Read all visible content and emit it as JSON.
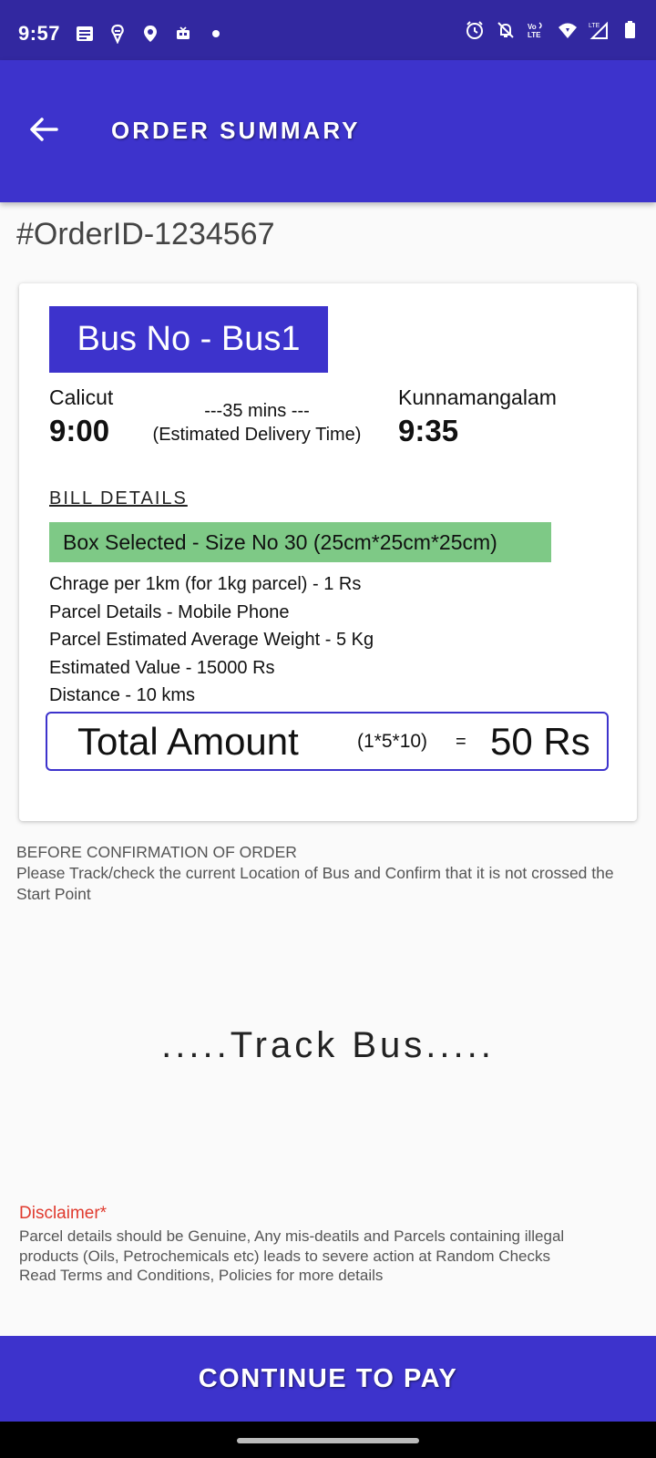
{
  "status_bar": {
    "time": "9:57",
    "left_icons": [
      "message-icon",
      "swiggy-icon",
      "location-icon",
      "media-icon",
      "dot-icon"
    ],
    "right_icons": [
      "alarm-icon",
      "notifications-off-icon",
      "volte-icon",
      "wifi-icon",
      "signal-icon",
      "battery-icon"
    ],
    "network_label": "LTE",
    "volte_label": "Vo LTE"
  },
  "app_bar": {
    "title": "ORDER SUMMARY",
    "back_icon": "arrow-left-icon"
  },
  "order_id": "#OrderID-1234567",
  "trip": {
    "bus_label": "Bus No - Bus1",
    "from_city": "Calicut",
    "from_time": "9:00",
    "duration": "---35 mins ---",
    "eta_label": "(Estimated Delivery Time)",
    "to_city": "Kunnamangalam",
    "to_time": "9:35"
  },
  "bill": {
    "heading": "BILL DETAILS",
    "box_selected": "Box Selected - Size No 30 (25cm*25cm*25cm)",
    "lines": [
      "Chrage per 1km (for 1kg parcel) - 1 Rs",
      "Parcel Details - Mobile Phone",
      "Parcel Estimated Average Weight - 5 Kg",
      "Estimated Value - 15000 Rs",
      "Distance - 10 kms"
    ],
    "total_label": "Total Amount",
    "total_formula": "(1*5*10)",
    "total_eq": "=",
    "total_value": "50 Rs"
  },
  "confirmation_note": {
    "line1": "BEFORE CONFIRMATION OF ORDER",
    "line2": "Please Track/check the current Location of Bus and Confirm that it is not crossed the Start Point"
  },
  "track_bus_label": ".....Track Bus.....",
  "disclaimer": {
    "title": "Disclaimer*",
    "lines": [
      "Parcel details should be Genuine, Any mis-deatils and Parcels containing illegal",
      "products (Oils, Petrochemicals etc) leads to severe action at Random Checks",
      "Read Terms and Conditions, Policies for more details"
    ]
  },
  "pay_button_label": "CONTINUE TO PAY",
  "colors": {
    "status_bar": "#3228a0",
    "primary": "#3d33cc",
    "box_chip": "#7ec986",
    "disclaimer_title": "#e03a2e"
  }
}
